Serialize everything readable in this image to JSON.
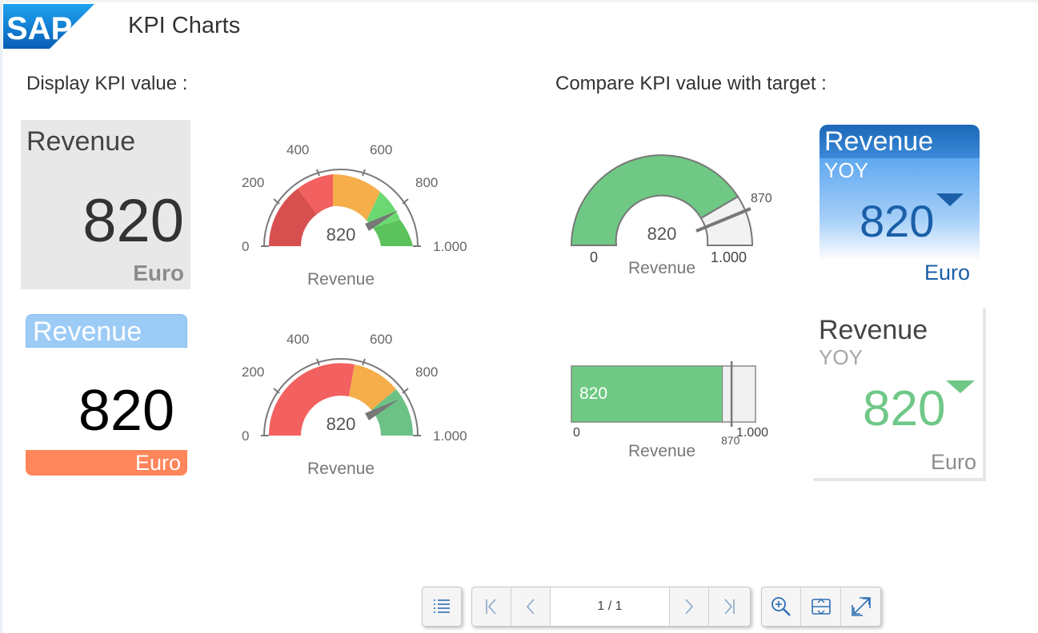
{
  "app": {
    "logo_text": "SAP",
    "title": "KPI Charts"
  },
  "sections": {
    "display": "Display KPI value :",
    "compare": "Compare KPI value with target :"
  },
  "tiles": [
    {
      "title": "Revenue",
      "value": "820",
      "unit": "Euro"
    },
    {
      "title": "Revenue",
      "value": "820",
      "unit": "Euro"
    },
    {
      "title": "Revenue",
      "subtitle": "YOY",
      "value": "820",
      "unit": "Euro",
      "trend": "down"
    },
    {
      "title": "Revenue",
      "subtitle": "YOY",
      "value": "820",
      "unit": "Euro",
      "trend": "down"
    }
  ],
  "gauges": [
    {
      "name": "gauge-1",
      "value": 820,
      "value_label": "820",
      "caption": "Revenue",
      "ticks": [
        "0",
        "200",
        "400",
        "600",
        "800",
        "1.000"
      ]
    },
    {
      "name": "gauge-2",
      "value": 820,
      "value_label": "820",
      "caption": "Revenue",
      "ticks": [
        "0",
        "200",
        "400",
        "600",
        "800",
        "1.000"
      ]
    },
    {
      "name": "target-gauge",
      "value": 820,
      "value_label": "820",
      "caption": "Revenue",
      "min_label": "0",
      "max_label": "1.000",
      "target": 870,
      "target_label": "870"
    }
  ],
  "bullet": {
    "value": 820,
    "max": 1000,
    "target": 870,
    "value_label": "820",
    "min_label": "0",
    "max_label": "1.000",
    "target_label": "870",
    "caption": "Revenue"
  },
  "toolbar": {
    "page_indicator": "1 / 1"
  },
  "colors": {
    "red": "#f2605f",
    "dark_red": "#d84f4f",
    "orange": "#f6ae4b",
    "green": "#6cd872",
    "dark_green": "#5cc25c",
    "kpi_green": "#70c887",
    "sap_blue": "#1a7bd1"
  }
}
